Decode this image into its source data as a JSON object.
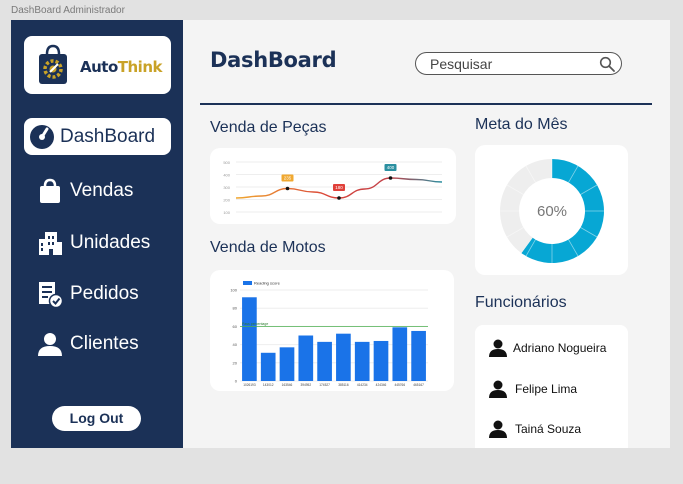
{
  "window": {
    "title": "DashBoard Administrador"
  },
  "brand": {
    "name_part1": "Auto",
    "name_part2": "Think"
  },
  "sidebar": {
    "items": [
      {
        "label": "DashBoard",
        "icon": "dashboard-gauge-icon",
        "active": true
      },
      {
        "label": "Vendas",
        "icon": "shopping-bag-icon"
      },
      {
        "label": "Unidades",
        "icon": "building-icon"
      },
      {
        "label": "Pedidos",
        "icon": "order-check-icon"
      },
      {
        "label": "Clientes",
        "icon": "user-icon"
      }
    ],
    "logout_label": "Log Out"
  },
  "header": {
    "title": "DashBoard",
    "search_placeholder": "Pesquisar"
  },
  "sections": {
    "pecas_title": "Venda de Peças",
    "motos_title": "Venda de Motos",
    "meta_title": "Meta do Mês",
    "func_title": "Funcionários"
  },
  "colors": {
    "navy": "#1b3157",
    "accent": "#07a7d4",
    "gold": "#c9a227",
    "bar": "#1a73e8"
  },
  "chart_data": [
    {
      "type": "line",
      "title": "Venda de Peças",
      "ylim": [
        0,
        500
      ],
      "yticks": [
        "500",
        "400",
        "300",
        "200",
        "100"
      ],
      "x": [
        0,
        1,
        2,
        3,
        4,
        5,
        6,
        7,
        8
      ],
      "values": [
        140,
        160,
        235,
        200,
        140,
        230,
        340,
        325,
        300
      ],
      "annotations": [
        {
          "x": 2,
          "label": "235"
        },
        {
          "x": 4,
          "label": "180"
        },
        {
          "x": 6,
          "label": "400"
        }
      ]
    },
    {
      "type": "bar",
      "title": "Venda de Motos",
      "legend": "Reading score",
      "reference_label": "Pass percentage",
      "reference_value": 60,
      "ylim": [
        0,
        100
      ],
      "yticks": [
        "100",
        "80",
        "60",
        "40",
        "20",
        "0"
      ],
      "categories": [
        "1026193",
        "143012",
        "163546",
        "394952",
        "174527",
        "385116",
        "414234",
        "424346",
        "445766",
        "465167"
      ],
      "values": [
        92,
        31,
        37,
        50,
        43,
        52,
        43,
        44,
        59,
        55
      ]
    },
    {
      "type": "pie",
      "title": "Meta do Mês",
      "center_label": "60%",
      "values": [
        60,
        40
      ],
      "colors": [
        "#07a7d4",
        "#eeeeee"
      ]
    }
  ],
  "employees": [
    {
      "name": "Adriano Nogueira"
    },
    {
      "name": "Felipe Lima"
    },
    {
      "name": "Tainá Souza"
    }
  ]
}
